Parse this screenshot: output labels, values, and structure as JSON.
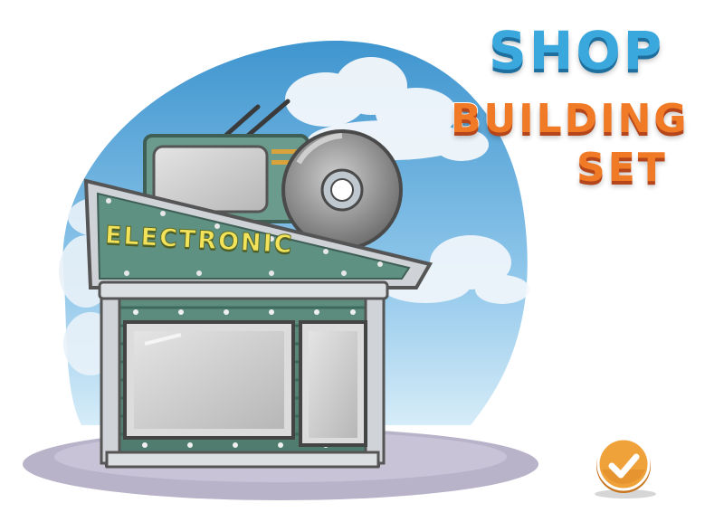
{
  "title": {
    "line1": "SHOP",
    "line2": "BUILDING",
    "line3": "SET"
  },
  "building": {
    "sign_text": "ELECTRONIC"
  },
  "icons": {
    "badge": "checkmark-icon",
    "roof_items": [
      "tv-icon",
      "disc-icon"
    ]
  },
  "colors": {
    "sky_top": "#3f95cf",
    "sky_bottom": "#d6ecf8",
    "building_green": "#6a9b8c",
    "title_blue": "#3aa8dc",
    "title_orange": "#f07a26",
    "badge_orange": "#f0a23a"
  }
}
